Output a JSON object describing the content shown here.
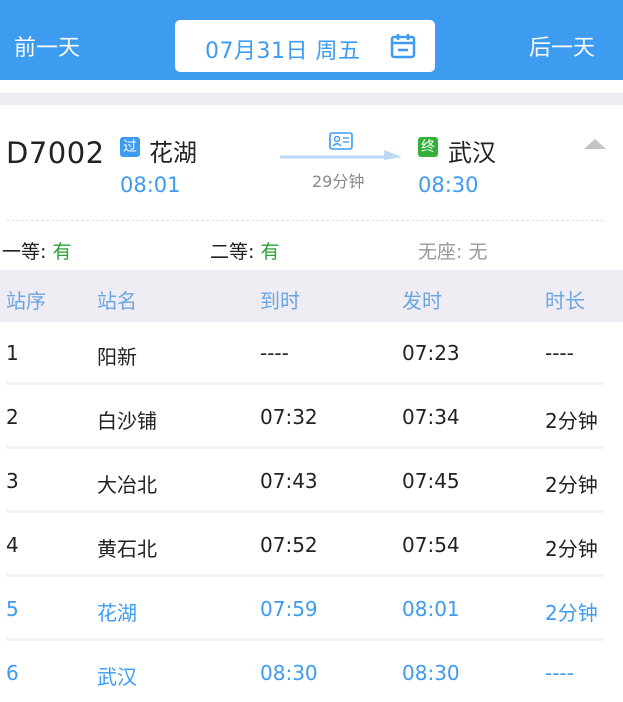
{
  "nav": {
    "prev_label": "前一天",
    "next_label": "后一天",
    "date_label": "07月31日 周五"
  },
  "train": {
    "number": "D7002",
    "from": {
      "badge": "过",
      "name": "花湖",
      "time": "08:01"
    },
    "to": {
      "badge": "终",
      "name": "武汉",
      "time": "08:30"
    },
    "duration": "29分钟"
  },
  "seats": [
    {
      "label": "一等:",
      "value": "有"
    },
    {
      "label": "二等:",
      "value": "有"
    },
    {
      "label": "无座:",
      "value": "无"
    }
  ],
  "table": {
    "headers": [
      "站序",
      "站名",
      "到时",
      "发时",
      "时长"
    ],
    "rows": [
      {
        "seq": "1",
        "station": "阳新",
        "arrive": "----",
        "depart": "07:23",
        "stay": "----",
        "highlight": false
      },
      {
        "seq": "2",
        "station": "白沙铺",
        "arrive": "07:32",
        "depart": "07:34",
        "stay": "2分钟",
        "highlight": false
      },
      {
        "seq": "3",
        "station": "大冶北",
        "arrive": "07:43",
        "depart": "07:45",
        "stay": "2分钟",
        "highlight": false
      },
      {
        "seq": "4",
        "station": "黄石北",
        "arrive": "07:52",
        "depart": "07:54",
        "stay": "2分钟",
        "highlight": false
      },
      {
        "seq": "5",
        "station": "花湖",
        "arrive": "07:59",
        "depart": "08:01",
        "stay": "2分钟",
        "highlight": true
      },
      {
        "seq": "6",
        "station": "武汉",
        "arrive": "08:30",
        "depart": "08:30",
        "stay": "----",
        "highlight": true
      }
    ]
  },
  "colors": {
    "accent": "#3d9bf0",
    "available": "#2fa136",
    "end_badge": "#33b03a",
    "muted": "#999999",
    "header_bg": "#efedf3"
  },
  "icons": {
    "calendar": "calendar-icon",
    "ticket": "id-card-icon",
    "collapse": "chevron-up-icon"
  }
}
